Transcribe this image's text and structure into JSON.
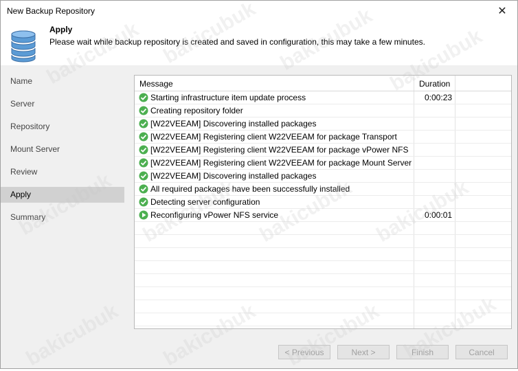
{
  "window": {
    "title": "New Backup Repository",
    "close_glyph": "✕"
  },
  "header": {
    "title": "Apply",
    "description": "Please wait while backup repository is created and saved in configuration, this may take a few minutes."
  },
  "nav": {
    "items": [
      {
        "label": "Name",
        "active": false
      },
      {
        "label": "Server",
        "active": false
      },
      {
        "label": "Repository",
        "active": false
      },
      {
        "label": "Mount Server",
        "active": false
      },
      {
        "label": "Review",
        "active": false
      },
      {
        "label": "Apply",
        "active": true
      },
      {
        "label": "Summary",
        "active": false
      }
    ]
  },
  "log": {
    "columns": [
      "Message",
      "Duration"
    ],
    "rows": [
      {
        "status": "success",
        "message": "Starting infrastructure item update process",
        "duration": "0:00:23"
      },
      {
        "status": "success",
        "message": "Creating repository folder",
        "duration": ""
      },
      {
        "status": "success",
        "message": "[W22VEEAM] Discovering installed packages",
        "duration": ""
      },
      {
        "status": "success",
        "message": "[W22VEEAM] Registering client W22VEEAM for package Transport",
        "duration": ""
      },
      {
        "status": "success",
        "message": "[W22VEEAM] Registering client W22VEEAM for package vPower NFS",
        "duration": ""
      },
      {
        "status": "success",
        "message": "[W22VEEAM] Registering client W22VEEAM for package Mount Server",
        "duration": ""
      },
      {
        "status": "success",
        "message": "[W22VEEAM] Discovering installed packages",
        "duration": ""
      },
      {
        "status": "success",
        "message": "All required packages have been successfully installed",
        "duration": ""
      },
      {
        "status": "success",
        "message": "Detecting server configuration",
        "duration": ""
      },
      {
        "status": "running",
        "message": "Reconfiguring vPower NFS service",
        "duration": "0:00:01"
      }
    ]
  },
  "footer": {
    "previous_label": "< Previous",
    "next_label": "Next >",
    "finish_label": "Finish",
    "cancel_label": "Cancel"
  },
  "watermark": "bakicubuk",
  "colors": {
    "success": "#4caf50",
    "running": "#4caf50",
    "selected_nav": "#d1d1d1"
  }
}
